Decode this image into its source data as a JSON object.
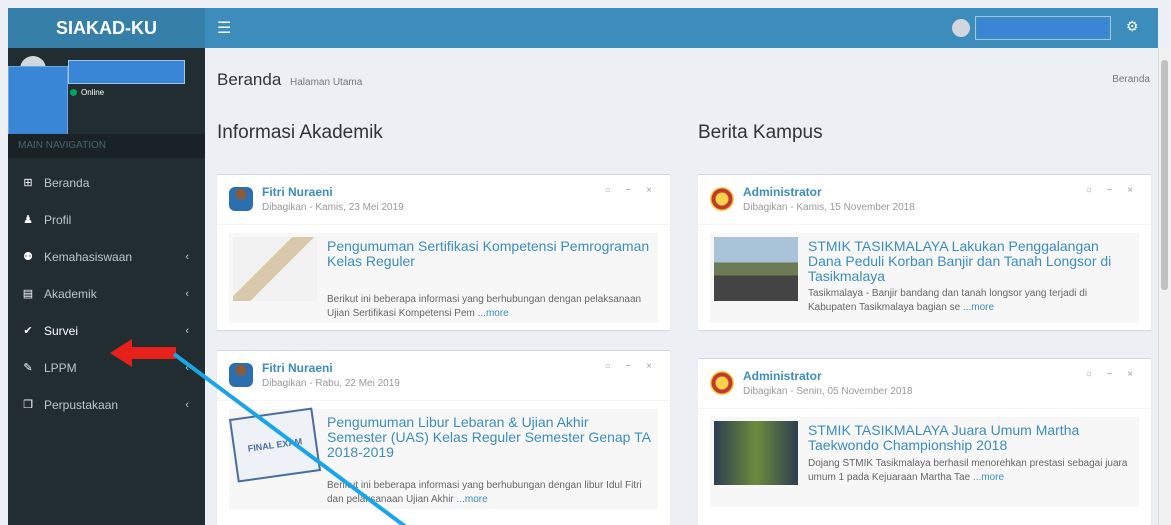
{
  "app": {
    "brand": "SIAKAD-KU",
    "menu_icon": "☰",
    "settings_icon": "gears-icon"
  },
  "sidebar": {
    "status": "Online",
    "section_header": "MAIN NAVIGATION",
    "items": [
      {
        "label": "Beranda",
        "icon": "dashboard-icon",
        "glyph": "⊞",
        "has_children": false
      },
      {
        "label": "Profil",
        "icon": "user-icon",
        "glyph": "♟",
        "has_children": false
      },
      {
        "label": "Kemahasiswaan",
        "icon": "group-icon",
        "glyph": "⚉",
        "has_children": true
      },
      {
        "label": "Akademik",
        "icon": "list-icon",
        "glyph": "▤",
        "has_children": true
      },
      {
        "label": "Survei",
        "icon": "check-circle-icon",
        "glyph": "✔",
        "has_children": true
      },
      {
        "label": "LPPM",
        "icon": "pen-icon",
        "glyph": "✎",
        "has_children": true
      },
      {
        "label": "Perpustakaan",
        "icon": "book-icon",
        "glyph": "❒",
        "has_children": true
      }
    ]
  },
  "content": {
    "title": "Beranda",
    "subtitle": "Halaman Utama",
    "breadcrumb": "Beranda",
    "left_heading": "Informasi Akademik",
    "right_heading": "Berita Kampus",
    "tools": "○ − ×",
    "left_cards": [
      {
        "author": "Fitri Nuraeni",
        "date": "Dibagikan - Kamis, 23 Mei 2019",
        "title": "Pengumuman Sertifikasi Kompetensi Pemrograman Kelas Reguler",
        "desc": "Berikut ini beberapa informasi yang berhubungan dengan pelaksanaan Ujian Sertifikasi Kompetensi Pem ",
        "more": "...more"
      },
      {
        "author": "Fitri Nuraeni",
        "date": "Dibagikan - Rabu, 22 Mei 2019",
        "title": "Pengumuman Libur Lebaran & Ujian Akhir Semester (UAS) Kelas Reguler Semester Genap TA 2018-2019",
        "desc": "Berikut ini beberapa informasi yang berhubungan dengan libur Idul Fitri dan pelaksanaan Ujian Akhir ",
        "more": "...more",
        "thumb_text": "FINAL EXAM"
      }
    ],
    "right_cards": [
      {
        "author": "Administrator",
        "date": "Dibagikan - Kamis, 15 November 2018",
        "title": "STMIK TASIKMALAYA Lakukan Penggalangan Dana Peduli Korban Banjir dan Tanah Longsor di Tasikmalaya",
        "desc": "Tasikmalaya - Banjir bandang dan tanah longsor yang terjadi di Kabupaten Tasikmalaya bagian se ",
        "more": "...more"
      },
      {
        "author": "Administrator",
        "date": "Dibagikan - Senin, 05 November 2018",
        "title": "STMIK TASIKMALAYA Juara Umum Martha Taekwondo Championship 2018",
        "desc": "Dojang STMIK Tasikmalaya berhasil menorehkan prestasi sebagai juara umum 1 pada Kejuaraan Martha Tae ",
        "more": "...more"
      }
    ]
  },
  "annotation_colors": {
    "arrow": "#e8201a",
    "line": "#1aa6e6"
  }
}
